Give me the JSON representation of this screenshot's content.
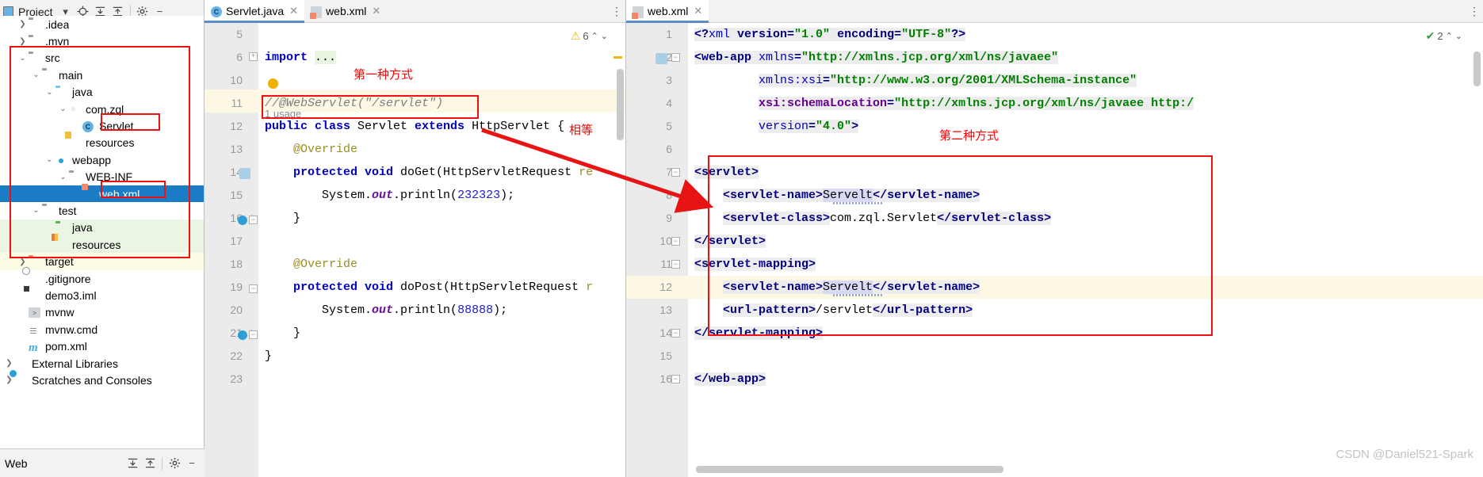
{
  "project_panel": {
    "title": "Project",
    "toolbar_icons": [
      "project-dropdown-icon",
      "locate-icon",
      "expand-all-icon",
      "collapse-all-icon",
      "settings-icon",
      "hide-icon"
    ],
    "tree": [
      {
        "label": ".idea",
        "icon": "folder-icon",
        "depth": 1,
        "arrow": ">",
        "state": "clipped"
      },
      {
        "label": ".mvn",
        "icon": "folder-icon",
        "depth": 1,
        "arrow": ">"
      },
      {
        "label": "src",
        "icon": "folder-icon",
        "depth": 1,
        "arrow": "v"
      },
      {
        "label": "main",
        "icon": "folder-icon",
        "depth": 2,
        "arrow": "v"
      },
      {
        "label": "java",
        "icon": "source-folder-icon",
        "depth": 3,
        "arrow": "v"
      },
      {
        "label": "com.zql",
        "icon": "package-icon",
        "depth": 4,
        "arrow": "v"
      },
      {
        "label": "Servlet",
        "icon": "java-class-icon",
        "depth": 5,
        "arrow": ""
      },
      {
        "label": "resources",
        "icon": "resources-folder-icon",
        "depth": 4,
        "arrow": ""
      },
      {
        "label": "webapp",
        "icon": "webapp-folder-icon",
        "depth": 3,
        "arrow": "v"
      },
      {
        "label": "WEB-INF",
        "icon": "folder-icon",
        "depth": 4,
        "arrow": "v"
      },
      {
        "label": "web.xml",
        "icon": "xml-file-icon",
        "depth": 5,
        "arrow": "",
        "selected": true
      },
      {
        "label": "test",
        "icon": "folder-icon",
        "depth": 2,
        "arrow": "v"
      },
      {
        "label": "java",
        "icon": "test-source-folder-icon",
        "depth": 3,
        "arrow": ""
      },
      {
        "label": "resources",
        "icon": "test-resources-folder-icon",
        "depth": 3,
        "arrow": ""
      },
      {
        "label": "target",
        "icon": "excluded-folder-icon",
        "depth": 1,
        "arrow": ">"
      },
      {
        "label": ".gitignore",
        "icon": "gitignore-file-icon",
        "depth": 1,
        "arrow": ""
      },
      {
        "label": "demo3.iml",
        "icon": "iml-file-icon",
        "depth": 1,
        "arrow": ""
      },
      {
        "label": "mvnw",
        "icon": "script-file-icon",
        "depth": 1,
        "arrow": ""
      },
      {
        "label": "mvnw.cmd",
        "icon": "text-file-icon",
        "depth": 1,
        "arrow": ""
      },
      {
        "label": "pom.xml",
        "icon": "maven-file-icon",
        "depth": 1,
        "arrow": ""
      },
      {
        "label": "External Libraries",
        "icon": "libraries-icon",
        "depth": 0,
        "arrow": ">"
      },
      {
        "label": "Scratches and Consoles",
        "icon": "scratches-icon",
        "depth": 0,
        "arrow": ">"
      }
    ]
  },
  "bottom_bar": {
    "label": "Web",
    "icons": [
      "expand-all-icon",
      "collapse-all-icon",
      "settings-icon",
      "hide-icon"
    ]
  },
  "center_editor": {
    "tabs": [
      {
        "label": "Servlet.java",
        "icon": "java-class-icon",
        "active": true
      },
      {
        "label": "web.xml",
        "icon": "xml-file-icon",
        "active": false
      }
    ],
    "inspection_badge": {
      "icon": "warning-icon",
      "count": "6"
    },
    "usage_hint": "1 usage",
    "lines": [
      {
        "num": "5",
        "text": ""
      },
      {
        "num": "6",
        "text": "import ..."
      },
      {
        "num": "10",
        "text": ""
      },
      {
        "num": "11",
        "text": "//@WebServlet(\"/servlet\")"
      },
      {
        "num": "12",
        "text": "public class Servlet extends HttpServlet {"
      },
      {
        "num": "13",
        "text": "    @Override"
      },
      {
        "num": "14",
        "text": "    protected void doGet(HttpServletRequest re"
      },
      {
        "num": "15",
        "text": "        System.out.println(232323);"
      },
      {
        "num": "16",
        "text": "    }"
      },
      {
        "num": "17",
        "text": ""
      },
      {
        "num": "18",
        "text": "    @Override"
      },
      {
        "num": "19",
        "text": "    protected void doPost(HttpServletRequest r"
      },
      {
        "num": "20",
        "text": "        System.out.println(88888);"
      },
      {
        "num": "21",
        "text": "    }"
      },
      {
        "num": "22",
        "text": "}"
      },
      {
        "num": "23",
        "text": ""
      }
    ]
  },
  "right_editor": {
    "tabs": [
      {
        "label": "web.xml",
        "icon": "xml-file-icon",
        "active": true
      }
    ],
    "inspection_badge": {
      "icon": "ok-icon",
      "count": "2"
    },
    "lines": [
      {
        "num": "1",
        "text": "<?xml version=\"1.0\" encoding=\"UTF-8\"?>"
      },
      {
        "num": "2",
        "text": "<web-app xmlns=\"http://xmlns.jcp.org/xml/ns/javaee\""
      },
      {
        "num": "3",
        "text": "         xmlns:xsi=\"http://www.w3.org/2001/XMLSchema-instance\""
      },
      {
        "num": "4",
        "text": "         xsi:schemaLocation=\"http://xmlns.jcp.org/xml/ns/javaee http:/"
      },
      {
        "num": "5",
        "text": "         version=\"4.0\">"
      },
      {
        "num": "6",
        "text": ""
      },
      {
        "num": "7",
        "text": "    <servlet>"
      },
      {
        "num": "8",
        "text": "        <servlet-name>Servelt</servlet-name>"
      },
      {
        "num": "9",
        "text": "        <servlet-class>com.zql.Servlet</servlet-class>"
      },
      {
        "num": "10",
        "text": "    </servlet>"
      },
      {
        "num": "11",
        "text": "    <servlet-mapping>"
      },
      {
        "num": "12",
        "text": "        <servlet-name>Servelt</servlet-name>"
      },
      {
        "num": "13",
        "text": "        <url-pattern>/servlet</url-pattern>"
      },
      {
        "num": "14",
        "text": "    </servlet-mapping>"
      },
      {
        "num": "15",
        "text": ""
      },
      {
        "num": "16",
        "text": "</web-app>"
      }
    ]
  },
  "annotations": {
    "first_method": "第一种方式",
    "equal": "相等",
    "second_method": "第二种方式"
  },
  "watermark": "CSDN @Daniel521-Spark",
  "colors": {
    "highlight_box": "#f01010",
    "selection_blue": "#1a7cc4",
    "annotation_red": "#ff0000"
  }
}
